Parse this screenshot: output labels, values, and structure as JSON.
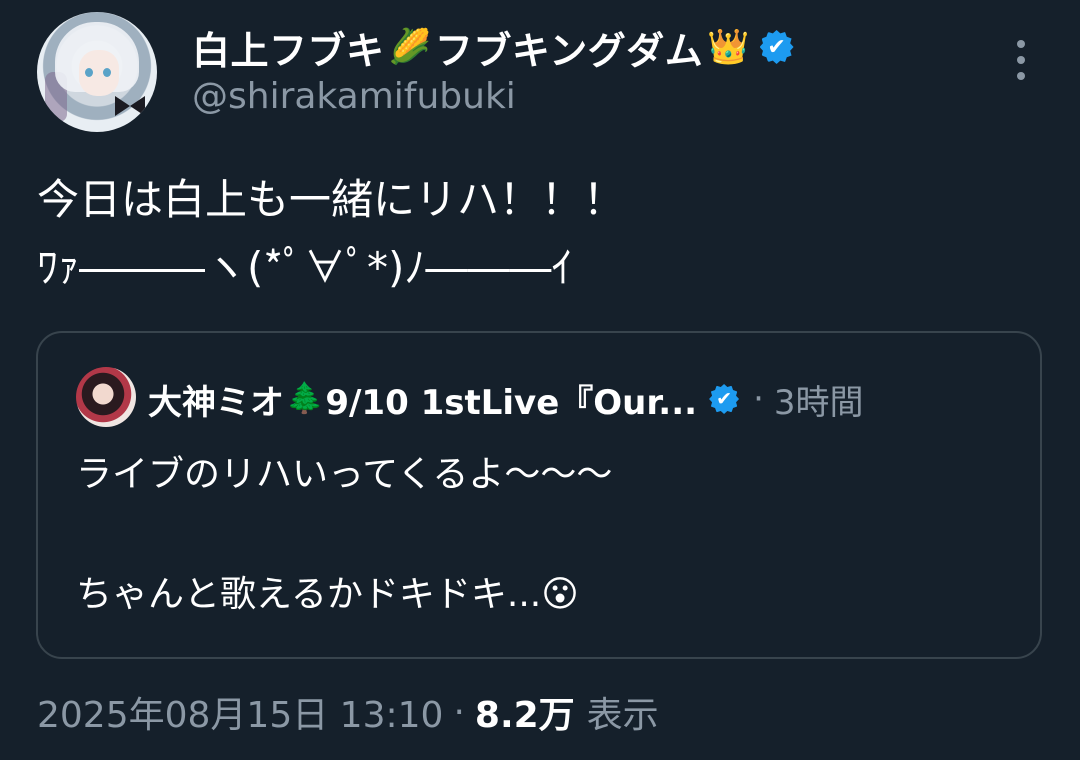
{
  "author": {
    "display_name": "白上フブキ",
    "name_emoji_1": "🌽",
    "name_suffix": "フブキングダム",
    "name_emoji_2": "👑",
    "verified_badge": "✔",
    "handle": "@shirakamifubuki"
  },
  "tweet": {
    "text": "今日は白上も一緒にリハ！！！\nﾜｧ―――ヽ(*ﾟ∀ﾟ*)ﾉ―――ｲ"
  },
  "quoted_tweet": {
    "author_name": "大神ミオ",
    "name_emoji": "🌲",
    "name_suffix": "9/10 1stLive『Our...",
    "verified_badge": "✔",
    "separator": "·",
    "time_ago": "3時間",
    "text": "ライブのリハいってくるよ〜〜〜\n\nちゃんと歌えるかドキドキ...😮"
  },
  "meta": {
    "timestamp": "2025年08月15日 13:10",
    "separator": "·",
    "views_count": "8.2万",
    "views_label": "表示"
  },
  "icons": {
    "more": "more-vertical-icon",
    "verified": "verified-badge-icon"
  },
  "colors": {
    "background": "#15202b",
    "verified": "#1d9bf0",
    "secondary_text": "#8b98a5",
    "border": "#38444d"
  }
}
